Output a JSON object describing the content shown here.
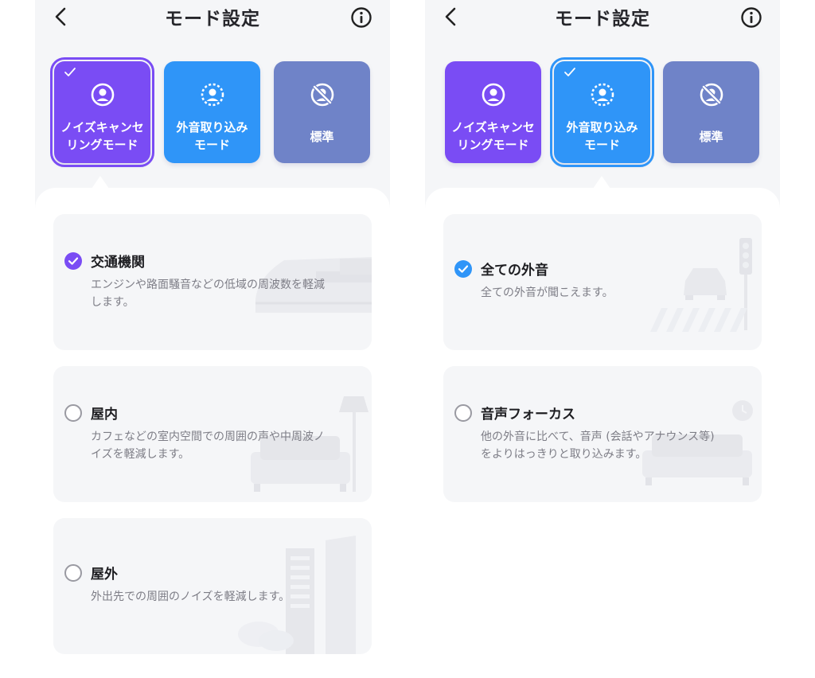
{
  "screens": [
    {
      "header": {
        "title": "モード設定"
      },
      "modes": [
        {
          "label": "ノイズキャンセ\nリングモード",
          "icon": "person-focus-icon",
          "color": "#7a4cf4",
          "selected": true
        },
        {
          "label": "外音取り込み\nモード",
          "icon": "person-ambient-icon",
          "color": "#2f95f8",
          "selected": false
        },
        {
          "label": "標準",
          "icon": "person-off-icon",
          "color": "#6f83c8",
          "selected": false
        }
      ],
      "options": [
        {
          "title": "交通機関",
          "desc": "エンジンや路面騒音などの低域の周波数を軽減\nします。",
          "selected": true,
          "illustration": "train-illustration"
        },
        {
          "title": "屋内",
          "desc": "カフェなどの室内空間での周囲の声や中周波ノ\nイズを軽減します。",
          "selected": false,
          "illustration": "sofa-lamp-illustration"
        },
        {
          "title": "屋外",
          "desc": "外出先での周囲のノイズを軽減します。",
          "selected": false,
          "illustration": "buildings-illustration"
        }
      ]
    },
    {
      "header": {
        "title": "モード設定"
      },
      "modes": [
        {
          "label": "ノイズキャンセ\nリングモード",
          "icon": "person-focus-icon",
          "color": "#7a4cf4",
          "selected": false
        },
        {
          "label": "外音取り込み\nモード",
          "icon": "person-ambient-icon",
          "color": "#2f95f8",
          "selected": true
        },
        {
          "label": "標準",
          "icon": "person-off-icon",
          "color": "#6f83c8",
          "selected": false
        }
      ],
      "options": [
        {
          "title": "全ての外音",
          "desc": "全ての外音が聞こえます。",
          "selected": true,
          "illustration": "traffic-illustration"
        },
        {
          "title": "音声フォーカス",
          "desc": "他の外音に比べて、音声 (会話やアナウンス等)\nをよりはっきりと取り込みます。",
          "selected": false,
          "illustration": "sofa-clock-illustration"
        }
      ]
    }
  ],
  "colors": {
    "check_left": "#7a4cf4",
    "check_right": "#2f95f8",
    "card_bg": "#f5f6f8"
  }
}
